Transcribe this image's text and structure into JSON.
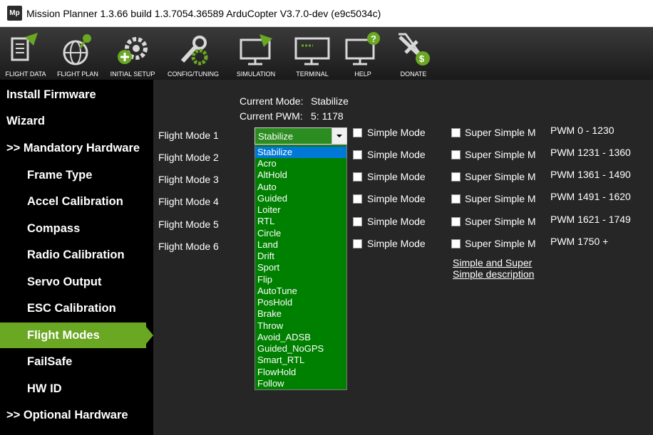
{
  "window": {
    "logo_text": "Mp",
    "title": "Mission Planner 1.3.66 build 1.3.7054.36589 ArduCopter V3.7.0-dev (e9c5034c)"
  },
  "toolbar": {
    "items": [
      {
        "label": "FLIGHT DATA",
        "icon": "flight-data-icon"
      },
      {
        "label": "FLIGHT PLAN",
        "icon": "flight-plan-icon"
      },
      {
        "label": "INITIAL SETUP",
        "icon": "initial-setup-icon"
      },
      {
        "label": "CONFIG/TUNING",
        "icon": "config-tuning-icon"
      },
      {
        "label": "SIMULATION",
        "icon": "simulation-icon"
      },
      {
        "label": "TERMINAL",
        "icon": "terminal-icon"
      },
      {
        "label": "HELP",
        "icon": "help-icon"
      },
      {
        "label": "DONATE",
        "icon": "donate-icon"
      }
    ]
  },
  "sidebar": {
    "items": [
      {
        "label": "Install Firmware"
      },
      {
        "label": "Wizard"
      },
      {
        "label": ">> Mandatory Hardware"
      },
      {
        "label": "Frame Type"
      },
      {
        "label": "Accel Calibration"
      },
      {
        "label": "Compass"
      },
      {
        "label": "Radio Calibration"
      },
      {
        "label": "Servo Output"
      },
      {
        "label": "ESC Calibration"
      },
      {
        "label": "Flight Modes"
      },
      {
        "label": "FailSafe"
      },
      {
        "label": "HW ID"
      },
      {
        "label": ">> Optional Hardware"
      }
    ],
    "active": "Flight Modes",
    "accent_color": "#6aa723"
  },
  "status": {
    "current_mode_label": "Current Mode:",
    "current_mode_value": "Stabilize",
    "current_pwm_label": "Current PWM:",
    "current_pwm_value": "5: 1178"
  },
  "flight_modes": [
    {
      "label": "Flight Mode 1",
      "simple": "Simple Mode",
      "super_simple": "Super  Simple M",
      "pwm": "PWM 0 - 1230"
    },
    {
      "label": "Flight Mode 2",
      "simple": "Simple Mode",
      "super_simple": "Super  Simple M",
      "pwm": "PWM 1231 - 1360"
    },
    {
      "label": "Flight Mode 3",
      "simple": "Simple Mode",
      "super_simple": "Super  Simple M",
      "pwm": "PWM 1361 - 1490"
    },
    {
      "label": "Flight Mode 4",
      "simple": "Simple Mode",
      "super_simple": "Super  Simple M",
      "pwm": "PWM 1491 - 1620"
    },
    {
      "label": "Flight Mode 5",
      "simple": "Simple Mode",
      "super_simple": "Super  Simple M",
      "pwm": "PWM 1621 - 1749"
    },
    {
      "label": "Flight Mode 6",
      "simple": "Simple Mode",
      "super_simple": "Super  Simple M",
      "pwm": "PWM 1750 +"
    }
  ],
  "mode_select": {
    "value": "Stabilize",
    "options": [
      "Stabilize",
      "Acro",
      "AltHold",
      "Auto",
      "Guided",
      "Loiter",
      "RTL",
      "Circle",
      "Land",
      "Drift",
      "Sport",
      "Flip",
      "AutoTune",
      "PosHold",
      "Brake",
      "Throw",
      "Avoid_ADSB",
      "Guided_NoGPS",
      "Smart_RTL",
      "FlowHold",
      "Follow"
    ],
    "highlighted": "Stabilize",
    "list_color": "#008000",
    "highlight_color": "#0078d7"
  },
  "help_link": {
    "line1": "Simple and Super",
    "line2": "Simple description"
  }
}
